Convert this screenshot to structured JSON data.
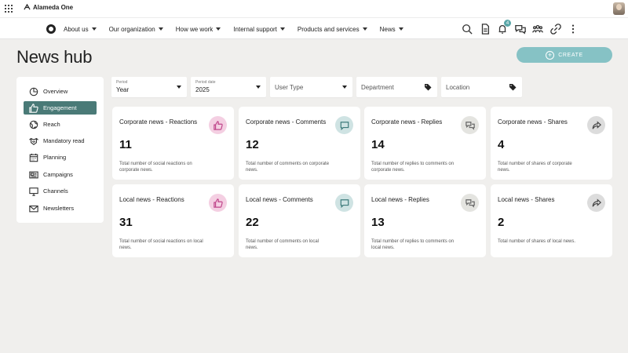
{
  "app": {
    "brand": "Alameda One"
  },
  "nav": {
    "items": [
      "About us",
      "Our organization",
      "How we work",
      "Internal support",
      "Products and services",
      "News"
    ],
    "notification_count": "4",
    "icons": [
      "search-icon",
      "document-icon",
      "bell-icon",
      "chat-icon",
      "people-icon",
      "link-icon",
      "more-icon"
    ]
  },
  "page": {
    "title": "News hub",
    "create_label": "CREATE"
  },
  "sidebar": {
    "items": [
      {
        "label": "Overview",
        "icon": "pie-chart-icon"
      },
      {
        "label": "Engagement",
        "icon": "thumbs-up-icon",
        "active": true
      },
      {
        "label": "Reach",
        "icon": "globe-icon"
      },
      {
        "label": "Mandatory read",
        "icon": "handshake-icon"
      },
      {
        "label": "Planning",
        "icon": "calendar-icon"
      },
      {
        "label": "Campaigns",
        "icon": "campaign-icon"
      },
      {
        "label": "Channels",
        "icon": "monitor-icon"
      },
      {
        "label": "Newsletters",
        "icon": "mail-icon"
      }
    ]
  },
  "filters": {
    "period": {
      "label": "Period",
      "value": "Year"
    },
    "period_date": {
      "label": "Period date",
      "value": "2025"
    },
    "user_type": {
      "placeholder": "User Type"
    },
    "department": {
      "placeholder": "Department"
    },
    "location": {
      "placeholder": "Location"
    }
  },
  "cards": [
    {
      "title": "Corporate news - Reactions",
      "value": "11",
      "desc": "Total number of social reactions on corporate news.",
      "icon": "thumbs-up-icon"
    },
    {
      "title": "Corporate news - Comments",
      "value": "12",
      "desc": "Total number of comments on corporate news.",
      "icon": "comment-icon"
    },
    {
      "title": "Corporate news - Replies",
      "value": "14",
      "desc": "Total number of replies to comments on corporate news.",
      "icon": "replies-icon"
    },
    {
      "title": "Corporate news - Shares",
      "value": "4",
      "desc": "Total number of shares of corporate news.",
      "icon": "share-icon"
    },
    {
      "title": "Local news - Reactions",
      "value": "31",
      "desc": "Total number of social reactions on local news.",
      "icon": "thumbs-up-icon"
    },
    {
      "title": "Local news - Comments",
      "value": "22",
      "desc": "Total number of comments on local news.",
      "icon": "comment-icon"
    },
    {
      "title": "Local news - Replies",
      "value": "13",
      "desc": "Total number of replies to comments on local news.",
      "icon": "replies-icon"
    },
    {
      "title": "Local news - Shares",
      "value": "2",
      "desc": "Total number of shares of local news.",
      "icon": "share-icon"
    }
  ],
  "colors": {
    "accent": "#4a7a77",
    "create_button": "#86c2c5",
    "reactions_bg": "#f4cfe2",
    "comments_bg": "#cfe3e3",
    "replies_bg": "#e4e4e0",
    "shares_bg": "#dcdcdc"
  }
}
